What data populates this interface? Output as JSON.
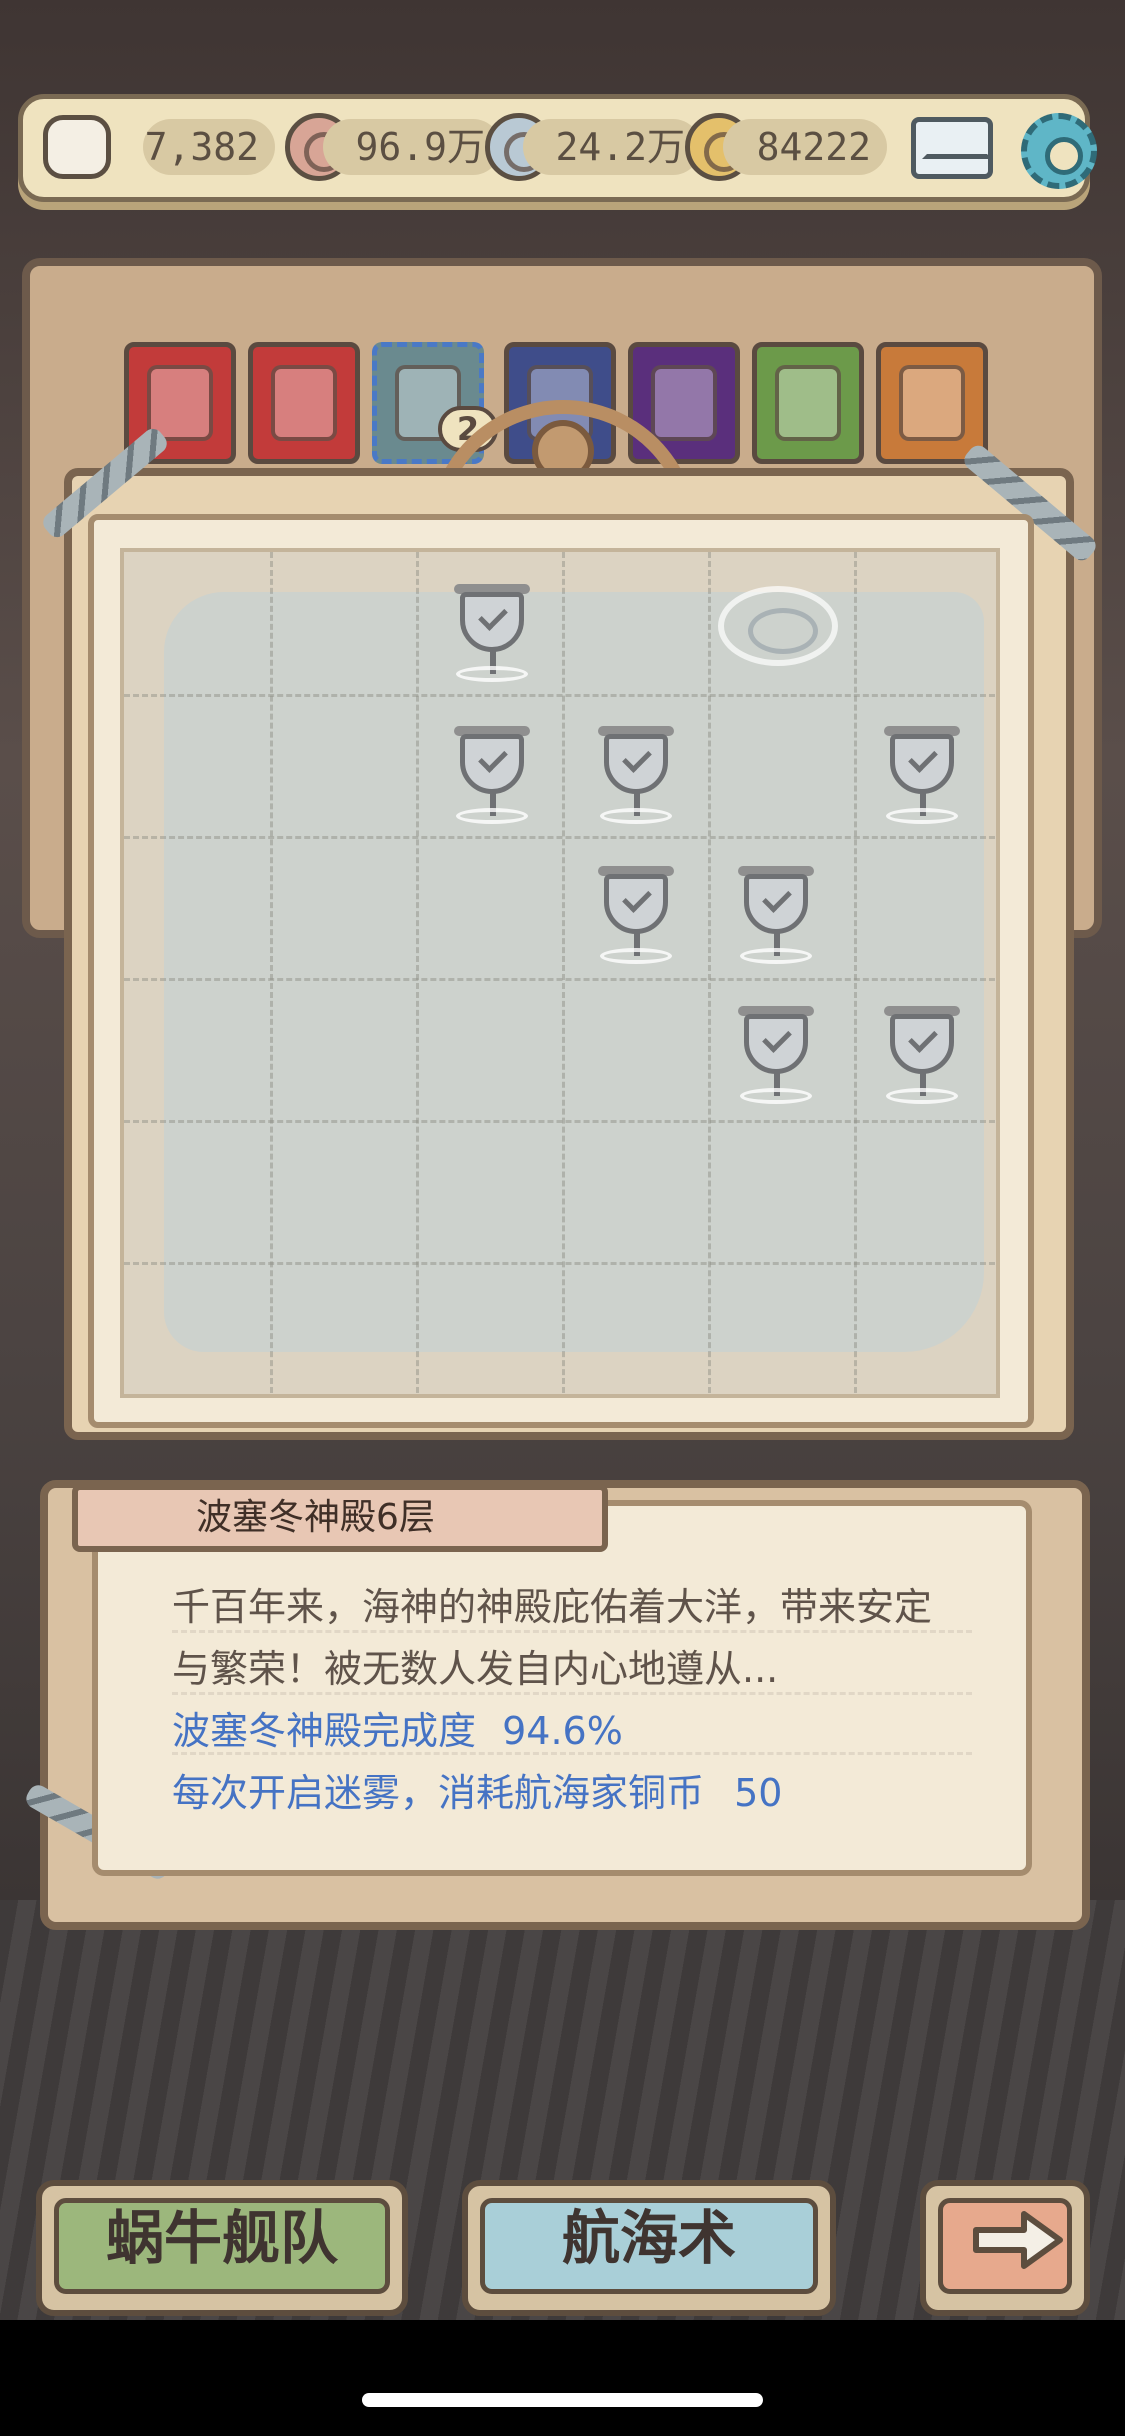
{
  "resources": {
    "snail_count": "7,382",
    "copper_coins": "96.9万",
    "silver_coins": "24.2万",
    "gold_coins": "84222"
  },
  "icons": {
    "snail": "snail-avatar-icon",
    "copper": "copper-coin-icon",
    "silver": "silver-coin-icon",
    "gold": "gold-coin-icon",
    "mail": "mail-icon",
    "settings": "gear-icon"
  },
  "items": {
    "badge_count": "2",
    "list": [
      {
        "name": "battery-item-icon",
        "color": "#c23b3a"
      },
      {
        "name": "battery-item-icon",
        "color": "#c23b3a"
      },
      {
        "name": "hourglass-item-icon",
        "color": "#6a8a8f"
      },
      {
        "name": "compass-item-icon",
        "color": "#3f4d8a"
      },
      {
        "name": "orb-item-icon",
        "color": "#5a2f7c"
      },
      {
        "name": "potion-item-icon",
        "color": "#6c9a4a"
      },
      {
        "name": "ticket-item-icon",
        "color": "#c87a3a"
      }
    ]
  },
  "map": {
    "title": "波塞冬神殿6层",
    "flags_cleared": 9
  },
  "info": {
    "description_line1": "千百年来，海神的神殿庇佑着大洋，带来安定",
    "description_line2": "与繁荣！被无数人发自内心地遵从...",
    "completion_label": "波塞冬神殿完成度",
    "completion_value": "94.6%",
    "cost_label": "每次开启迷雾，消耗航海家铜币",
    "cost_value": "50"
  },
  "buttons": {
    "fleet": "蜗牛舰队",
    "navigation": "航海术"
  },
  "colors": {
    "fleet_button": "#9cb77c",
    "navigation_button": "#a9cfd8",
    "next_button": "#e7a98d",
    "info_blue": "#4573c4"
  }
}
